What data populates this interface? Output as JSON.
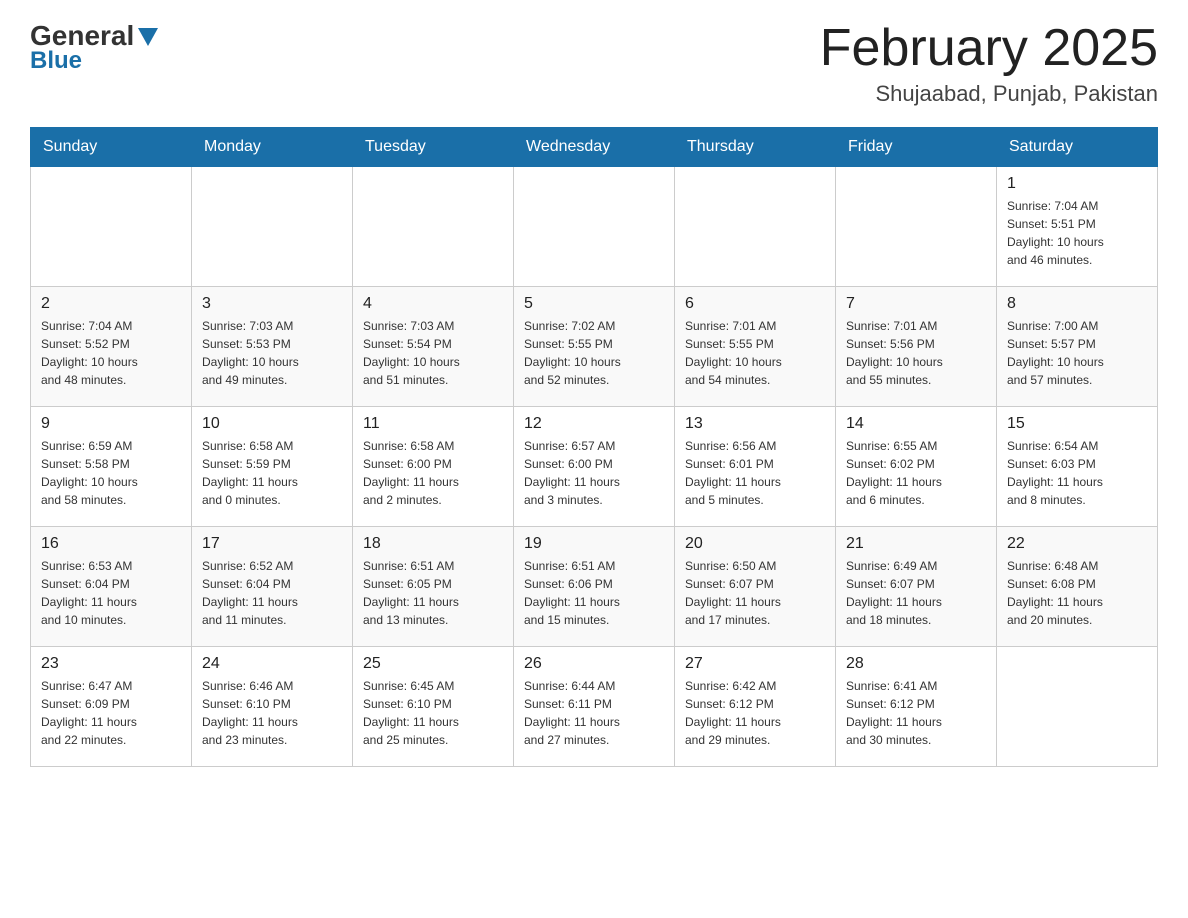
{
  "header": {
    "logo": {
      "general": "General",
      "blue": "Blue"
    },
    "title": "February 2025",
    "subtitle": "Shujaabad, Punjab, Pakistan"
  },
  "weekdays": [
    "Sunday",
    "Monday",
    "Tuesday",
    "Wednesday",
    "Thursday",
    "Friday",
    "Saturday"
  ],
  "weeks": [
    [
      {
        "day": "",
        "info": ""
      },
      {
        "day": "",
        "info": ""
      },
      {
        "day": "",
        "info": ""
      },
      {
        "day": "",
        "info": ""
      },
      {
        "day": "",
        "info": ""
      },
      {
        "day": "",
        "info": ""
      },
      {
        "day": "1",
        "info": "Sunrise: 7:04 AM\nSunset: 5:51 PM\nDaylight: 10 hours\nand 46 minutes."
      }
    ],
    [
      {
        "day": "2",
        "info": "Sunrise: 7:04 AM\nSunset: 5:52 PM\nDaylight: 10 hours\nand 48 minutes."
      },
      {
        "day": "3",
        "info": "Sunrise: 7:03 AM\nSunset: 5:53 PM\nDaylight: 10 hours\nand 49 minutes."
      },
      {
        "day": "4",
        "info": "Sunrise: 7:03 AM\nSunset: 5:54 PM\nDaylight: 10 hours\nand 51 minutes."
      },
      {
        "day": "5",
        "info": "Sunrise: 7:02 AM\nSunset: 5:55 PM\nDaylight: 10 hours\nand 52 minutes."
      },
      {
        "day": "6",
        "info": "Sunrise: 7:01 AM\nSunset: 5:55 PM\nDaylight: 10 hours\nand 54 minutes."
      },
      {
        "day": "7",
        "info": "Sunrise: 7:01 AM\nSunset: 5:56 PM\nDaylight: 10 hours\nand 55 minutes."
      },
      {
        "day": "8",
        "info": "Sunrise: 7:00 AM\nSunset: 5:57 PM\nDaylight: 10 hours\nand 57 minutes."
      }
    ],
    [
      {
        "day": "9",
        "info": "Sunrise: 6:59 AM\nSunset: 5:58 PM\nDaylight: 10 hours\nand 58 minutes."
      },
      {
        "day": "10",
        "info": "Sunrise: 6:58 AM\nSunset: 5:59 PM\nDaylight: 11 hours\nand 0 minutes."
      },
      {
        "day": "11",
        "info": "Sunrise: 6:58 AM\nSunset: 6:00 PM\nDaylight: 11 hours\nand 2 minutes."
      },
      {
        "day": "12",
        "info": "Sunrise: 6:57 AM\nSunset: 6:00 PM\nDaylight: 11 hours\nand 3 minutes."
      },
      {
        "day": "13",
        "info": "Sunrise: 6:56 AM\nSunset: 6:01 PM\nDaylight: 11 hours\nand 5 minutes."
      },
      {
        "day": "14",
        "info": "Sunrise: 6:55 AM\nSunset: 6:02 PM\nDaylight: 11 hours\nand 6 minutes."
      },
      {
        "day": "15",
        "info": "Sunrise: 6:54 AM\nSunset: 6:03 PM\nDaylight: 11 hours\nand 8 minutes."
      }
    ],
    [
      {
        "day": "16",
        "info": "Sunrise: 6:53 AM\nSunset: 6:04 PM\nDaylight: 11 hours\nand 10 minutes."
      },
      {
        "day": "17",
        "info": "Sunrise: 6:52 AM\nSunset: 6:04 PM\nDaylight: 11 hours\nand 11 minutes."
      },
      {
        "day": "18",
        "info": "Sunrise: 6:51 AM\nSunset: 6:05 PM\nDaylight: 11 hours\nand 13 minutes."
      },
      {
        "day": "19",
        "info": "Sunrise: 6:51 AM\nSunset: 6:06 PM\nDaylight: 11 hours\nand 15 minutes."
      },
      {
        "day": "20",
        "info": "Sunrise: 6:50 AM\nSunset: 6:07 PM\nDaylight: 11 hours\nand 17 minutes."
      },
      {
        "day": "21",
        "info": "Sunrise: 6:49 AM\nSunset: 6:07 PM\nDaylight: 11 hours\nand 18 minutes."
      },
      {
        "day": "22",
        "info": "Sunrise: 6:48 AM\nSunset: 6:08 PM\nDaylight: 11 hours\nand 20 minutes."
      }
    ],
    [
      {
        "day": "23",
        "info": "Sunrise: 6:47 AM\nSunset: 6:09 PM\nDaylight: 11 hours\nand 22 minutes."
      },
      {
        "day": "24",
        "info": "Sunrise: 6:46 AM\nSunset: 6:10 PM\nDaylight: 11 hours\nand 23 minutes."
      },
      {
        "day": "25",
        "info": "Sunrise: 6:45 AM\nSunset: 6:10 PM\nDaylight: 11 hours\nand 25 minutes."
      },
      {
        "day": "26",
        "info": "Sunrise: 6:44 AM\nSunset: 6:11 PM\nDaylight: 11 hours\nand 27 minutes."
      },
      {
        "day": "27",
        "info": "Sunrise: 6:42 AM\nSunset: 6:12 PM\nDaylight: 11 hours\nand 29 minutes."
      },
      {
        "day": "28",
        "info": "Sunrise: 6:41 AM\nSunset: 6:12 PM\nDaylight: 11 hours\nand 30 minutes."
      },
      {
        "day": "",
        "info": ""
      }
    ]
  ]
}
